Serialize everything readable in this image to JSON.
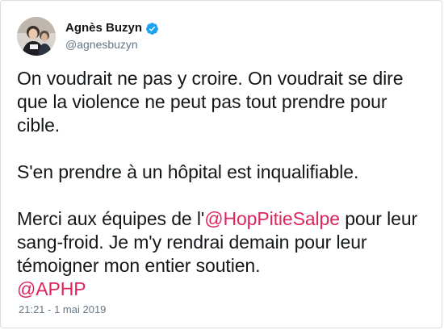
{
  "tweet": {
    "author": {
      "display_name": "Agnès Buzyn",
      "handle": "@agnesbuzyn",
      "verified": true,
      "avatar_icon": "profile-photo"
    },
    "paragraphs": [
      {
        "line1": "On voudrait ne pas y croire. On voudrait se dire que la violence ne peut pas tout prendre pour cible."
      },
      {
        "line1": "S'en prendre à un hôpital est inqualifiable."
      },
      {
        "before": "Merci aux équipes de l'",
        "mention1": "@HopPitieSalpe",
        "middle": " pour leur sang-froid. Je m'y rendrai demain pour leur témoigner mon entier soutien.",
        "mention2": "@APHP"
      }
    ],
    "timestamp": "21:21 - 1 mai 2019",
    "colors": {
      "mention": "#e0245e",
      "verified_badge": "#1da1f2",
      "secondary_text": "#657786"
    }
  }
}
